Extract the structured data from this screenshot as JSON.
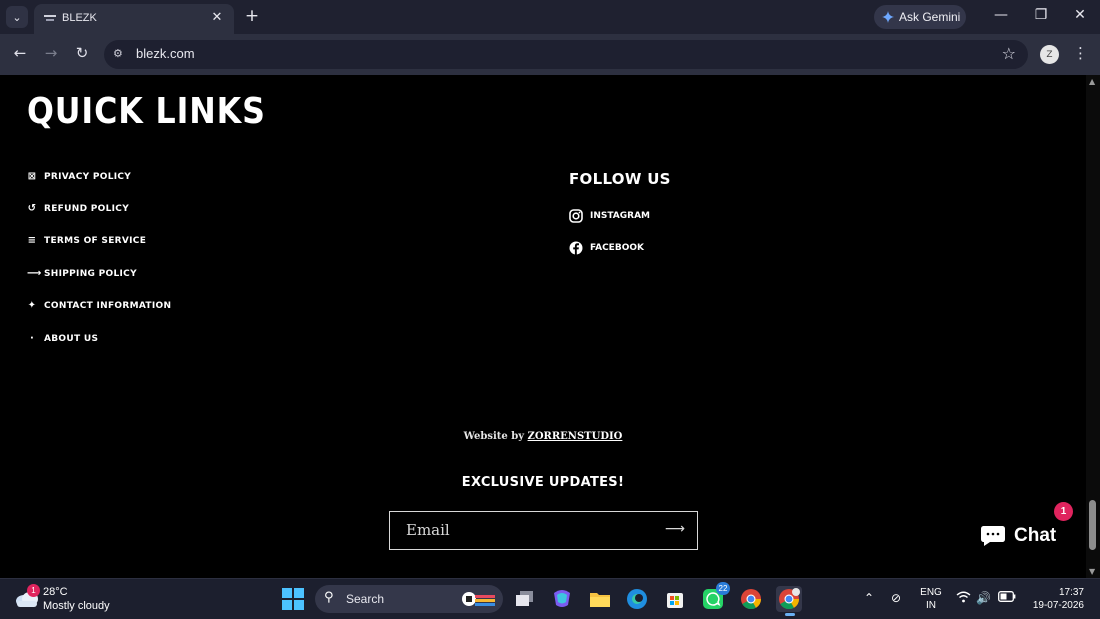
{
  "browser": {
    "tab_title": "BLEZK",
    "url": "blezk.com",
    "gemini_label": "Ask Gemini",
    "profile_initial": "Z"
  },
  "page": {
    "quick_links_heading": "QUICK LINKS",
    "quick_links": [
      {
        "icon": "box-icon",
        "label": "PRIVACY POLICY"
      },
      {
        "icon": "refresh-icon",
        "label": "REFUND POLICY"
      },
      {
        "icon": "list-icon",
        "label": "TERMS OF SERVICE"
      },
      {
        "icon": "arrow-right-icon",
        "label": "SHIPPING POLICY"
      },
      {
        "icon": "sparkle-icon",
        "label": "CONTACT INFORMATION"
      },
      {
        "icon": "dot-icon",
        "label": "ABOUT US"
      }
    ],
    "follow_heading": "FOLLOW US",
    "socials": [
      {
        "icon": "instagram-icon",
        "label": "INSTAGRAM"
      },
      {
        "icon": "facebook-icon",
        "label": "FACEBOOK"
      }
    ],
    "credit_prefix": "Website by",
    "credit_link": "ZORRENSTUDIO",
    "updates_heading": "EXCLUSIVE UPDATES!",
    "email_placeholder": "Email",
    "chat_label": "Chat",
    "chat_badge": "1"
  },
  "taskbar": {
    "weather_temp": "28°C",
    "weather_condition": "Mostly cloudy",
    "weather_badge": "1",
    "search_label": "Search",
    "whatsapp_badge": "22",
    "lang_top": "ENG",
    "lang_bottom": "IN",
    "time": "17:37",
    "date": "19-07-2026"
  }
}
